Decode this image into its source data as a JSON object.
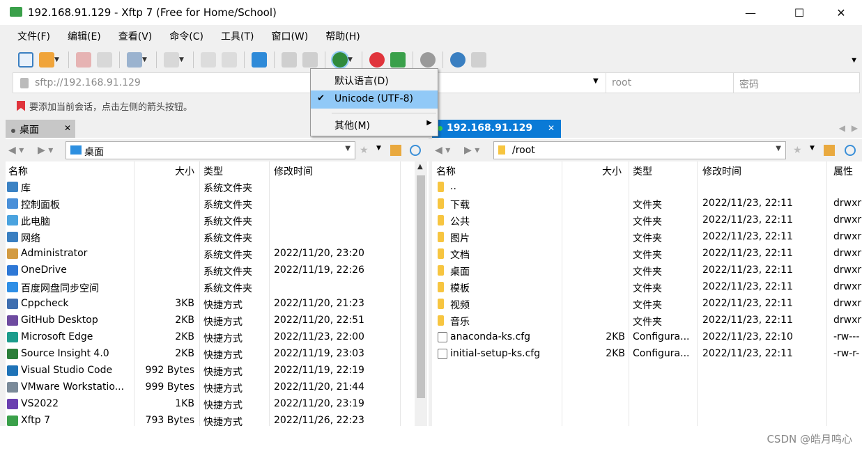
{
  "window": {
    "title": "192.168.91.129 - Xftp 7 (Free for Home/School)",
    "minimize": "—",
    "maximize": "☐",
    "close": "✕"
  },
  "menu": [
    "文件(F)",
    "编辑(E)",
    "查看(V)",
    "命令(C)",
    "工具(T)",
    "窗口(W)",
    "帮助(H)"
  ],
  "address": {
    "url": "sftp://192.168.91.129",
    "user": "root",
    "password_placeholder": "密码"
  },
  "hint": "要添加当前会话，点击左侧的箭头按钮。",
  "encoding_menu": {
    "items": [
      "默认语言(D)",
      "Unicode (UTF-8)",
      "其他(M)"
    ],
    "checked": "Unicode (UTF-8)"
  },
  "left_pane": {
    "tab": "桌面",
    "path": "桌面",
    "columns": [
      "名称",
      "大小",
      "类型",
      "修改时间"
    ],
    "rows": [
      {
        "name": "库",
        "size": "",
        "type": "系统文件夹",
        "mtime": ""
      },
      {
        "name": "控制面板",
        "size": "",
        "type": "系统文件夹",
        "mtime": ""
      },
      {
        "name": "此电脑",
        "size": "",
        "type": "系统文件夹",
        "mtime": ""
      },
      {
        "name": "网络",
        "size": "",
        "type": "系统文件夹",
        "mtime": ""
      },
      {
        "name": "Administrator",
        "size": "",
        "type": "系统文件夹",
        "mtime": "2022/11/20, 23:20"
      },
      {
        "name": "OneDrive",
        "size": "",
        "type": "系统文件夹",
        "mtime": "2022/11/19, 22:26"
      },
      {
        "name": "百度网盘同步空间",
        "size": "",
        "type": "系统文件夹",
        "mtime": ""
      },
      {
        "name": "Cppcheck",
        "size": "3KB",
        "type": "快捷方式",
        "mtime": "2022/11/20, 21:23"
      },
      {
        "name": "GitHub Desktop",
        "size": "2KB",
        "type": "快捷方式",
        "mtime": "2022/11/20, 22:51"
      },
      {
        "name": "Microsoft Edge",
        "size": "2KB",
        "type": "快捷方式",
        "mtime": "2022/11/23, 22:00"
      },
      {
        "name": "Source Insight 4.0",
        "size": "2KB",
        "type": "快捷方式",
        "mtime": "2022/11/19, 23:03"
      },
      {
        "name": "Visual Studio Code",
        "size": "992 Bytes",
        "type": "快捷方式",
        "mtime": "2022/11/19, 22:19"
      },
      {
        "name": "VMware Workstatio...",
        "size": "999 Bytes",
        "type": "快捷方式",
        "mtime": "2022/11/20, 21:44"
      },
      {
        "name": "VS2022",
        "size": "1KB",
        "type": "快捷方式",
        "mtime": "2022/11/20, 23:19"
      },
      {
        "name": "Xftp 7",
        "size": "793 Bytes",
        "type": "快捷方式",
        "mtime": "2022/11/26, 22:23"
      }
    ]
  },
  "right_pane": {
    "tab": "192.168.91.129",
    "path": "/root",
    "columns": [
      "名称",
      "大小",
      "类型",
      "修改时间",
      "属性"
    ],
    "rows": [
      {
        "name": "..",
        "size": "",
        "type": "",
        "mtime": "",
        "attr": "",
        "icon": "folder"
      },
      {
        "name": "下载",
        "size": "",
        "type": "文件夹",
        "mtime": "2022/11/23, 22:11",
        "attr": "drwxr",
        "icon": "folder"
      },
      {
        "name": "公共",
        "size": "",
        "type": "文件夹",
        "mtime": "2022/11/23, 22:11",
        "attr": "drwxr",
        "icon": "folder"
      },
      {
        "name": "图片",
        "size": "",
        "type": "文件夹",
        "mtime": "2022/11/23, 22:11",
        "attr": "drwxr",
        "icon": "folder"
      },
      {
        "name": "文档",
        "size": "",
        "type": "文件夹",
        "mtime": "2022/11/23, 22:11",
        "attr": "drwxr",
        "icon": "folder"
      },
      {
        "name": "桌面",
        "size": "",
        "type": "文件夹",
        "mtime": "2022/11/23, 22:11",
        "attr": "drwxr",
        "icon": "folder"
      },
      {
        "name": "模板",
        "size": "",
        "type": "文件夹",
        "mtime": "2022/11/23, 22:11",
        "attr": "drwxr",
        "icon": "folder"
      },
      {
        "name": "视频",
        "size": "",
        "type": "文件夹",
        "mtime": "2022/11/23, 22:11",
        "attr": "drwxr",
        "icon": "folder"
      },
      {
        "name": "音乐",
        "size": "",
        "type": "文件夹",
        "mtime": "2022/11/23, 22:11",
        "attr": "drwxr",
        "icon": "folder"
      },
      {
        "name": "anaconda-ks.cfg",
        "size": "2KB",
        "type": "Configura...",
        "mtime": "2022/11/23, 22:10",
        "attr": "-rw---",
        "icon": "cfg"
      },
      {
        "name": "initial-setup-ks.cfg",
        "size": "2KB",
        "type": "Configura...",
        "mtime": "2022/11/23, 22:11",
        "attr": "-rw-r-",
        "icon": "cfg"
      }
    ]
  },
  "watermark": "CSDN @皓月鸣心",
  "colors": {
    "accent": "#0a7ad6",
    "menu_highlight": "#91c9f7",
    "folder": "#f7c540"
  }
}
